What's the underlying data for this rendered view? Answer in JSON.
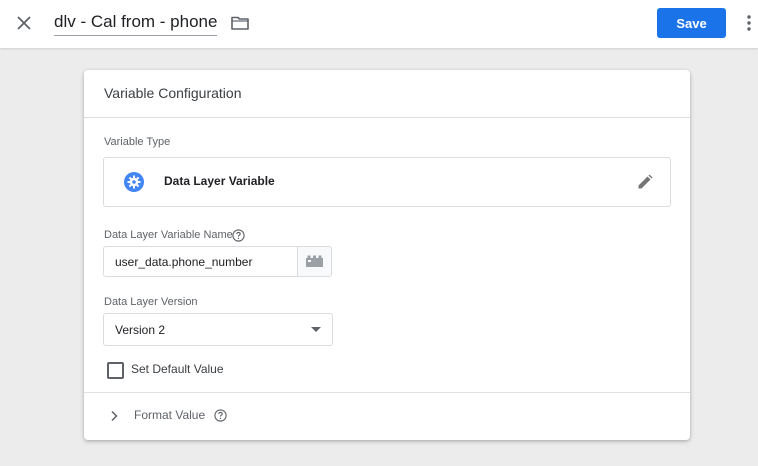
{
  "header": {
    "title": "dlv - Cal from - phone",
    "save_label": "Save"
  },
  "card": {
    "title": "Variable Configuration",
    "variable_type_label": "Variable Type",
    "variable_type_name": "Data Layer Variable",
    "dlv_name_label": "Data Layer Variable Name",
    "dlv_name_value": "user_data.phone_number",
    "dlv_version_label": "Data Layer Version",
    "dlv_version_value": "Version 2",
    "default_value_label": "Set Default Value",
    "default_value_checked": false,
    "format_value_label": "Format Value"
  },
  "colors": {
    "accent": "#1a73e8",
    "background": "#ececec"
  },
  "icons": {
    "close": "close-icon",
    "folder": "folder-icon",
    "more": "more-vert-icon",
    "variable_type": "gear-icon",
    "edit": "pencil-icon",
    "help": "help-icon",
    "variable_picker": "building-blocks-icon",
    "dropdown": "arrow-drop-down-icon",
    "expand": "chevron-right-icon"
  }
}
